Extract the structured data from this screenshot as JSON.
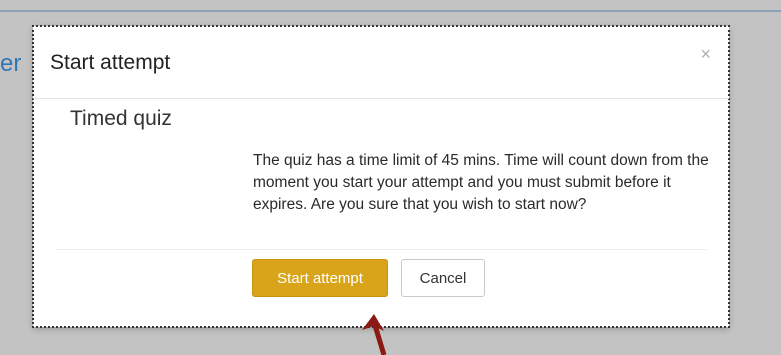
{
  "background": {
    "partial_heading": "er"
  },
  "dialog": {
    "title": "Start attempt",
    "close_glyph": "×",
    "subtitle": "Timed quiz",
    "message": "The quiz has a time limit of 45 mins. Time will count down from the moment you start your attempt and you must submit before it expires. Are you sure that you wish to start now?",
    "primary_button": "Start attempt",
    "secondary_button": "Cancel"
  },
  "colors": {
    "primary": "#d9a41a",
    "annotation_arrow": "#8b1a14",
    "link_blue": "#2f78b5"
  },
  "icons": {
    "close": "close-icon",
    "annotation": "arrow-annotation-icon"
  }
}
